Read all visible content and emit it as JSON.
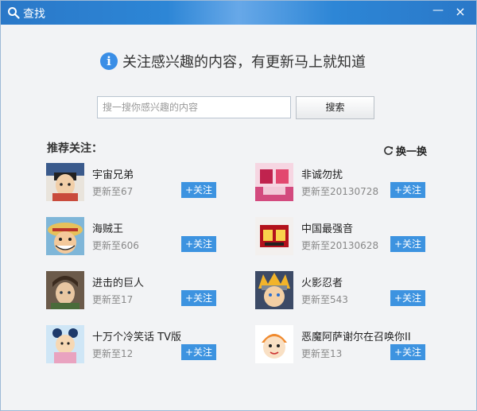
{
  "window": {
    "title": "查找",
    "minimize_label": "—",
    "close_label": "×"
  },
  "headline": "关注感兴趣的内容，有更新马上就知道",
  "search": {
    "placeholder": "搜一搜你感兴趣的内容",
    "button_label": "搜索"
  },
  "section_title": "推荐关注：",
  "refresh_label": "换一换",
  "follow_label": "+关注",
  "items": [
    {
      "name": "宇宙兄弟",
      "status": "更新至67"
    },
    {
      "name": "非诚勿扰",
      "status": "更新至20130728"
    },
    {
      "name": "海贼王",
      "status": "更新至606"
    },
    {
      "name": "中国最强音",
      "status": "更新至20130628"
    },
    {
      "name": "进击的巨人",
      "status": "更新至17"
    },
    {
      "name": "火影忍者",
      "status": "更新至543"
    },
    {
      "name": "十万个冷笑话 TV版",
      "status": "更新至12"
    },
    {
      "name": "恶魔阿萨谢尔在召唤你II",
      "status": "更新至13"
    }
  ],
  "colors": {
    "titlebar": "#2a78c8",
    "accent": "#3d93e0",
    "info": "#3a8ee6"
  }
}
